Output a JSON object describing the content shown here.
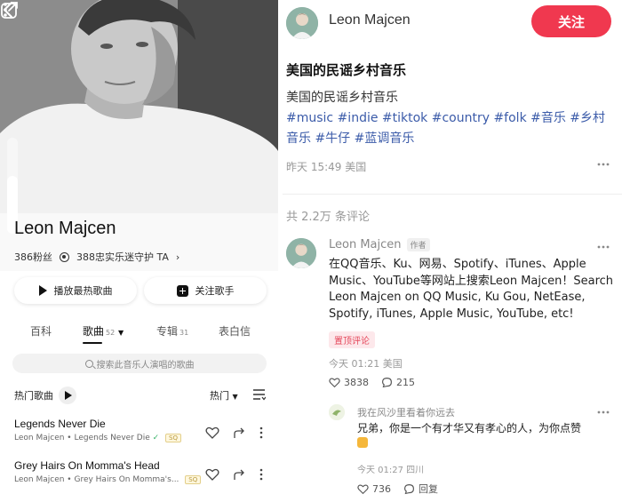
{
  "left": {
    "artist_name": "Leon Majcen",
    "fans": "386粉丝",
    "guardians": "388忠实乐迷守护 TA",
    "play_hot_label": "播放最热歌曲",
    "follow_label": "关注歌手",
    "tabs": [
      {
        "label": "百科",
        "count": ""
      },
      {
        "label": "歌曲",
        "count": "52"
      },
      {
        "label": "专辑",
        "count": "31"
      },
      {
        "label": "表白信",
        "count": ""
      }
    ],
    "search_placeholder": "搜索此音乐人演唱的歌曲",
    "hot_songs_label": "热门歌曲",
    "sort_label": "热门",
    "songs": [
      {
        "title": "Legends Never Die",
        "artist": "Leon Majcen",
        "album": "Legends Never Die",
        "badge": "SQ"
      },
      {
        "title": "Grey Hairs On Momma's Head",
        "artist": "Leon Majcen",
        "album": "Grey Hairs On Momma's...",
        "badge": "SQ"
      }
    ]
  },
  "right": {
    "author": "Leon Majcen",
    "follow_label": "关注",
    "title": "美国的民谣乡村音乐",
    "desc": "美国的民谣乡村音乐",
    "tags": "#music #indie #tiktok #country #folk #音乐 #乡村音乐 #牛仔 #蓝调音乐",
    "date": "昨天 15:49 美国",
    "comment_total": "共 2.2万 条评论",
    "comment": {
      "name": "Leon Majcen",
      "author_tag": "作者",
      "text": "在QQ音乐、Ku、网易、Spotify、iTunes、Apple Music、YouTube等网站上搜索Leon Majcen！Search Leon Majcen on QQ Music, Ku Gou, NetEase, Spotify, iTunes, Apple Music, YouTube, etc!",
      "pinned": "置顶评论",
      "date": "今天 01:21 美国",
      "likes": "3838",
      "replies": "215"
    },
    "reply": {
      "name": "我在风沙里看着你远去",
      "text": "兄弟，你是一个有才华又有孝心的人，为你点赞",
      "date": "今天 01:27 四川",
      "likes": "736",
      "reply_label": "回复"
    }
  },
  "colors": {
    "follow_red": "#f0384f",
    "tag_blue": "#3b5ba9",
    "pin_red": "#e5485b"
  }
}
